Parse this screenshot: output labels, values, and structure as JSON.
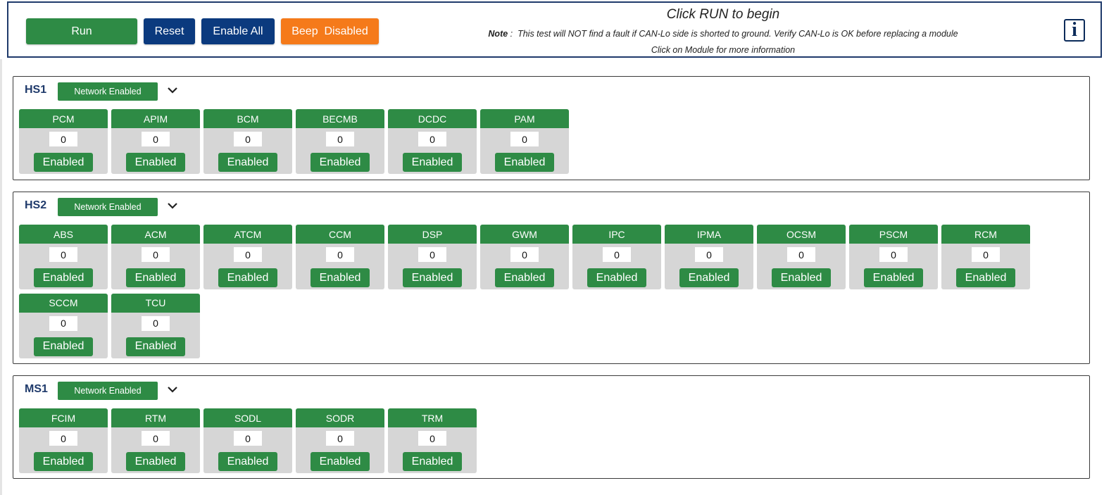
{
  "toolbar": {
    "run_label": "Run",
    "reset_label": "Reset",
    "enable_all_label": "Enable All",
    "beep_label": "Beep  Disabled",
    "status_title": "Click RUN to begin",
    "note_label": "Note",
    "note_text": " :  This test will NOT find a fault if CAN-Lo side is shorted to ground. Verify CAN-Lo is OK before replacing a module",
    "module_info": "Click on Module for more information",
    "info_glyph": "i"
  },
  "colors": {
    "green": "#2e8b45",
    "navy": "#0b3a7e",
    "orange": "#f57a1a",
    "module_bg": "#d6d6d6"
  },
  "networks": [
    {
      "name": "HS1",
      "status": "Network Enabled",
      "modules": [
        {
          "name": "PCM",
          "count": "0",
          "state": "Enabled"
        },
        {
          "name": "APIM",
          "count": "0",
          "state": "Enabled"
        },
        {
          "name": "BCM",
          "count": "0",
          "state": "Enabled"
        },
        {
          "name": "BECMB",
          "count": "0",
          "state": "Enabled"
        },
        {
          "name": "DCDC",
          "count": "0",
          "state": "Enabled"
        },
        {
          "name": "PAM",
          "count": "0",
          "state": "Enabled"
        }
      ]
    },
    {
      "name": "HS2",
      "status": "Network Enabled",
      "modules": [
        {
          "name": "ABS",
          "count": "0",
          "state": "Enabled"
        },
        {
          "name": "ACM",
          "count": "0",
          "state": "Enabled"
        },
        {
          "name": "ATCM",
          "count": "0",
          "state": "Enabled"
        },
        {
          "name": "CCM",
          "count": "0",
          "state": "Enabled"
        },
        {
          "name": "DSP",
          "count": "0",
          "state": "Enabled"
        },
        {
          "name": "GWM",
          "count": "0",
          "state": "Enabled"
        },
        {
          "name": "IPC",
          "count": "0",
          "state": "Enabled"
        },
        {
          "name": "IPMA",
          "count": "0",
          "state": "Enabled"
        },
        {
          "name": "OCSM",
          "count": "0",
          "state": "Enabled"
        },
        {
          "name": "PSCM",
          "count": "0",
          "state": "Enabled"
        },
        {
          "name": "RCM",
          "count": "0",
          "state": "Enabled"
        },
        {
          "name": "SCCM",
          "count": "0",
          "state": "Enabled"
        },
        {
          "name": "TCU",
          "count": "0",
          "state": "Enabled"
        }
      ]
    },
    {
      "name": "MS1",
      "status": "Network Enabled",
      "modules": [
        {
          "name": "FCIM",
          "count": "0",
          "state": "Enabled"
        },
        {
          "name": "RTM",
          "count": "0",
          "state": "Enabled"
        },
        {
          "name": "SODL",
          "count": "0",
          "state": "Enabled"
        },
        {
          "name": "SODR",
          "count": "0",
          "state": "Enabled"
        },
        {
          "name": "TRM",
          "count": "0",
          "state": "Enabled"
        }
      ]
    }
  ]
}
